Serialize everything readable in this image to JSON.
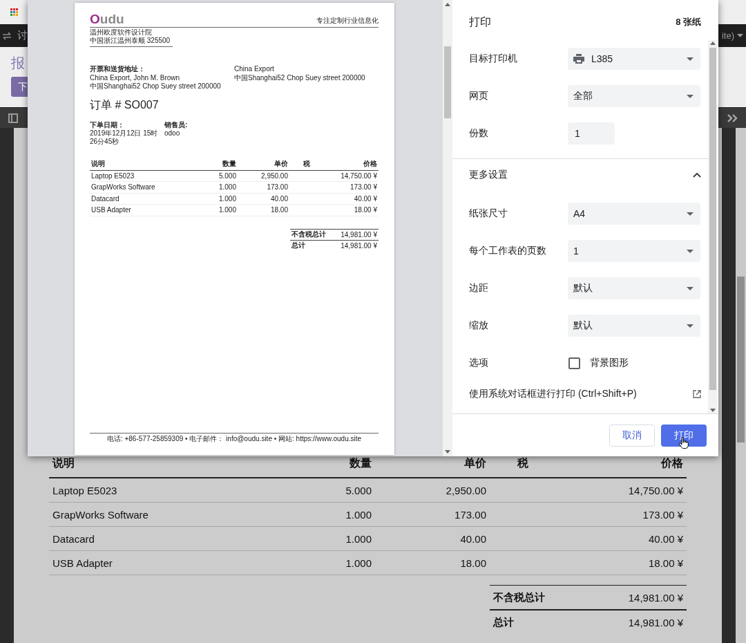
{
  "background": {
    "nav_left": "讨",
    "nav_right": "ite)",
    "breadcrumb": "报",
    "button": "下",
    "table": {
      "columns": [
        "说明",
        "数量",
        "单价",
        "税",
        "价格"
      ],
      "rows": [
        [
          "Laptop E5023",
          "5.000",
          "2,950.00",
          "",
          "14,750.00 ¥"
        ],
        [
          "GrapWorks Software",
          "1.000",
          "173.00",
          "",
          "173.00 ¥"
        ],
        [
          "Datacard",
          "1.000",
          "40.00",
          "",
          "40.00 ¥"
        ],
        [
          "USB Adapter",
          "1.000",
          "18.00",
          "",
          "18.00 ¥"
        ]
      ]
    },
    "totals": [
      {
        "label": "不含税总计",
        "value": "14,981.00 ¥"
      },
      {
        "label": "总计",
        "value": "14,981.00 ¥"
      }
    ]
  },
  "preview": {
    "logo": [
      "O",
      "udu"
    ],
    "slogan": "专注定制行业信息化",
    "company": [
      "温州欧度软件设计院",
      "中国浙江温州泰顺 325500"
    ],
    "address_label": "开票和送货地址：",
    "address": [
      "China Export, John M. Brown",
      "中国Shanghai52 Chop Suey street 200000"
    ],
    "shipping": [
      "China Export",
      "中国Shanghai52 Chop Suey street 200000"
    ],
    "title": "订单 # SO007",
    "info": [
      {
        "label": "下单日期：",
        "value": "2019年12月12日 15时26分45秒"
      },
      {
        "label": "销售员:",
        "value": "odoo"
      }
    ],
    "table": {
      "columns": [
        "说明",
        "数量",
        "单价",
        "税",
        "价格"
      ],
      "rows": [
        [
          "Laptop E5023",
          "5.000",
          "2,950.00",
          "",
          "14,750.00 ¥"
        ],
        [
          "GrapWorks Software",
          "1.000",
          "173.00",
          "",
          "173.00 ¥"
        ],
        [
          "Datacard",
          "1.000",
          "40.00",
          "",
          "40.00 ¥"
        ],
        [
          "USB Adapter",
          "1.000",
          "18.00",
          "",
          "18.00 ¥"
        ]
      ]
    },
    "totals": [
      {
        "label": "不含税总计",
        "value": "14,981.00 ¥"
      },
      {
        "label": "总计",
        "value": "14,981.00 ¥"
      }
    ],
    "footer": "电话: +86-577-25859309 • 电子邮件： info@oudu.site • 网站: https://www.oudu.site"
  },
  "dialog": {
    "title": "打印",
    "sheets": "8 张纸",
    "settings": [
      {
        "kind": "printer",
        "label": "目标打印机",
        "value": "L385"
      },
      {
        "kind": "select",
        "label": "网页",
        "value": "全部"
      },
      {
        "kind": "number",
        "label": "份数",
        "value": "1"
      }
    ],
    "more": {
      "label": "更多设置",
      "expanded": true
    },
    "more_settings": [
      {
        "kind": "select",
        "label": "纸张尺寸",
        "value": "A4"
      },
      {
        "kind": "select",
        "label": "每个工作表的页数",
        "value": "1"
      },
      {
        "kind": "select",
        "label": "边距",
        "value": "默认"
      },
      {
        "kind": "select",
        "label": "缩放",
        "value": "默认"
      },
      {
        "kind": "checkbox",
        "label": "选项",
        "value": "背景图形",
        "checked": false
      }
    ],
    "system_dialog": "使用系统对话框进行打印 (Ctrl+Shift+P)",
    "buttons": [
      {
        "label": "取消",
        "kind": "secondary"
      },
      {
        "label": "打印",
        "kind": "primary"
      }
    ]
  }
}
